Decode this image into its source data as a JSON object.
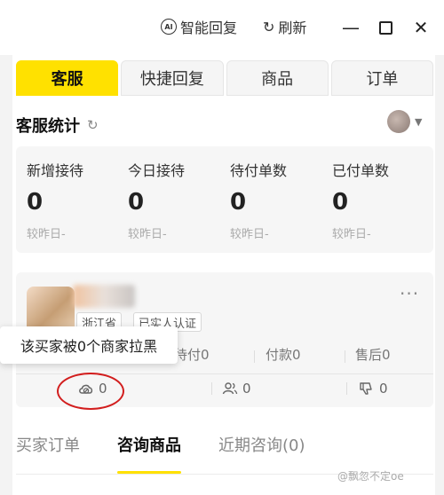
{
  "titlebar": {
    "ai_reply": "智能回复",
    "refresh": "刷新",
    "icons": [
      "ai-icon",
      "refresh-icon",
      "minimize-icon",
      "maximize-icon",
      "close-icon"
    ]
  },
  "tabs": [
    {
      "label": "客服",
      "active": true
    },
    {
      "label": "快捷回复",
      "active": false
    },
    {
      "label": "商品",
      "active": false
    },
    {
      "label": "订单",
      "active": false
    }
  ],
  "accent_color": "#ffe100",
  "stats": {
    "title": "客服统计",
    "items": [
      {
        "label": "新增接待",
        "value": "0",
        "compare": "较昨日-"
      },
      {
        "label": "今日接待",
        "value": "0",
        "compare": "较昨日-"
      },
      {
        "label": "待付单数",
        "value": "0",
        "compare": "较昨日-"
      },
      {
        "label": "已付单数",
        "value": "0",
        "compare": "较昨日-"
      }
    ]
  },
  "buyer": {
    "tags": [
      "浙江省",
      "已实人认证"
    ],
    "metrics": [
      "待付0",
      "付款0",
      "售后0"
    ],
    "footer": [
      {
        "icon": "blacklist-icon",
        "value": "0"
      },
      {
        "icon": "users-icon",
        "value": "0"
      },
      {
        "icon": "thumbs-down-icon",
        "value": "0"
      }
    ],
    "tooltip": "该买家被0个商家拉黑"
  },
  "bottom_tabs": [
    {
      "label": "买家订单",
      "active": false
    },
    {
      "label": "咨询商品",
      "active": true
    },
    {
      "label": "近期咨询(0)",
      "active": false
    }
  ],
  "watermark": "@飘忽不定oe"
}
